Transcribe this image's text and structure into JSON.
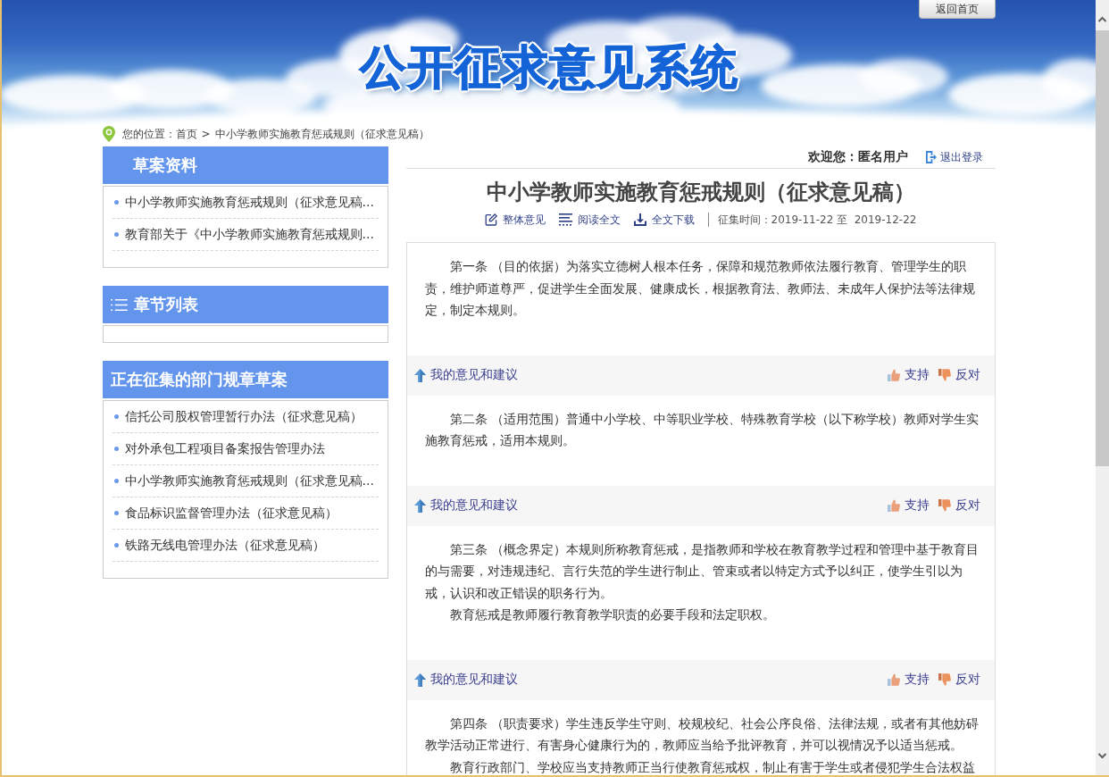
{
  "header": {
    "title": "公开征求意见系统",
    "home_button": "返回首页"
  },
  "breadcrumb": {
    "label": "您的位置：",
    "separator": ">",
    "items": [
      "首页",
      "中小学教师实施教育惩戒规则（征求意见稿）"
    ]
  },
  "sidebar": {
    "panels": [
      {
        "kind": "materials",
        "title": "草案资料",
        "items": [
          "中小学教师实施教育惩戒规则（征求意见稿...",
          "教育部关于《中小学教师实施教育惩戒规则..."
        ]
      },
      {
        "kind": "chapters",
        "title": "章节列表"
      },
      {
        "kind": "collecting",
        "title": "正在征集的部门规章草案",
        "items": [
          "信托公司股权管理暂行办法（征求意见稿）",
          "对外承包工程项目备案报告管理办法",
          "中小学教师实施教育惩戒规则（征求意见稿...",
          "食品标识监督管理办法（征求意见稿）",
          "铁路无线电管理办法（征求意见稿）"
        ]
      }
    ]
  },
  "user_bar": {
    "welcome": "欢迎您：匿名用户",
    "logout": "退出登录"
  },
  "document": {
    "title": "中小学教师实施教育惩戒规则（征求意见稿）",
    "actions": [
      {
        "kind": "edit",
        "label": "整体意见"
      },
      {
        "kind": "read",
        "label": "阅读全文"
      },
      {
        "kind": "download",
        "label": "全文下载"
      }
    ],
    "period": "征集时间：2019-11-22 至  2019-12-22",
    "articles": [
      {
        "paragraphs": [
          "第一条 （目的依据）为落实立德树人根本任务，保障和规范教师依法履行教育、管理学生的职责，维护师道尊严，促进学生全面发展、健康成长，根据教育法、教师法、未成年人保护法等法律规定，制定本规则。"
        ],
        "feedback": {
          "label": "我的意见和建议",
          "support": "支持",
          "oppose": "反对"
        }
      },
      {
        "paragraphs": [
          "第二条 （适用范围）普通中小学校、中等职业学校、特殊教育学校（以下称学校）教师对学生实施教育惩戒，适用本规则。"
        ],
        "feedback": {
          "label": "我的意见和建议",
          "support": "支持",
          "oppose": "反对"
        }
      },
      {
        "paragraphs": [
          "第三条 （概念界定）本规则所称教育惩戒，是指教师和学校在教育教学过程和管理中基于教育目的与需要，对违规违纪、言行失范的学生进行制止、管束或者以特定方式予以纠正，使学生引以为戒，认识和改正错误的职务行为。",
          "教育惩戒是教师履行教育教学职责的必要手段和法定职权。"
        ],
        "feedback": {
          "label": "我的意见和建议",
          "support": "支持",
          "oppose": "反对"
        }
      },
      {
        "paragraphs": [
          "第四条 （职责要求）学生违反学生守则、校规校纪、社会公序良俗、法律法规，或者有其他妨碍教学活动正常进行、有害身心健康行为的，教师应当给予批评教育，并可以视情况予以适当惩戒。",
          "教育行政部门、学校应当支持教师正当行使教育惩戒权，制止有害于学生或者侵犯学生合法权益"
        ]
      }
    ]
  }
}
